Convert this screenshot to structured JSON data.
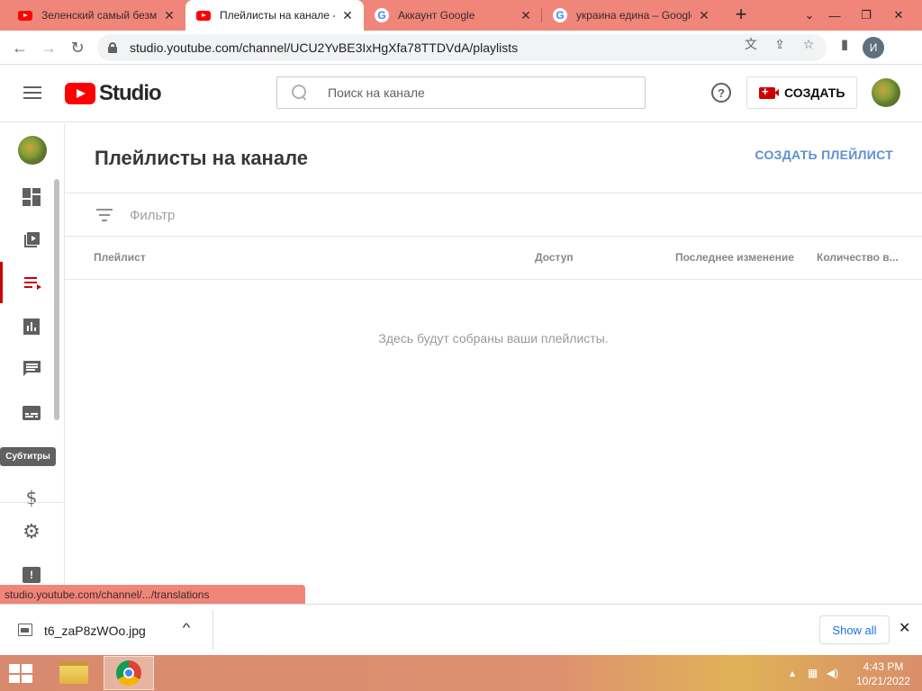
{
  "browser": {
    "tabs": [
      {
        "title": "Зеленский самый безмо",
        "favicon": "youtube-icon",
        "active": false
      },
      {
        "title": "Плейлисты на канале - Y",
        "favicon": "youtube-icon",
        "active": true
      },
      {
        "title": "Аккаунт Google",
        "favicon": "google-icon",
        "active": false
      },
      {
        "title": "украина едина – Google",
        "favicon": "google-icon",
        "active": false
      }
    ],
    "url": "studio.youtube.com/channel/UCU2YvBE3IxHgXfa78TTDVdA/playlists",
    "profile_initial": "И"
  },
  "studio": {
    "logo_text": "Studio",
    "search_placeholder": "Поиск на канале",
    "create_label": "СОЗДАТЬ",
    "help_glyph": "?"
  },
  "sidebar": {
    "items": [
      {
        "name": "dashboard",
        "icon": "dashboard-icon"
      },
      {
        "name": "content",
        "icon": "video-library-icon"
      },
      {
        "name": "playlists",
        "icon": "playlist-icon",
        "active": true
      },
      {
        "name": "analytics",
        "icon": "analytics-icon"
      },
      {
        "name": "comments",
        "icon": "comment-icon"
      },
      {
        "name": "subtitles",
        "icon": "subtitles-icon"
      },
      {
        "name": "monetization",
        "icon": "dollar-icon"
      },
      {
        "name": "settings",
        "icon": "gear-icon"
      },
      {
        "name": "feedback",
        "icon": "feedback-icon"
      }
    ],
    "tooltip": "Субтитры",
    "money_glyph": "$",
    "gear_glyph": "⚙",
    "feedback_glyph": "!"
  },
  "main": {
    "title": "Плейлисты на канале",
    "create_playlist": "СОЗДАТЬ ПЛЕЙЛИСТ",
    "filter_placeholder": "Фильтр",
    "columns": [
      "Плейлист",
      "Доступ",
      "Последнее изменение",
      "Количество в..."
    ],
    "empty_message": "Здесь будут собраны ваши плейлисты."
  },
  "status_url": "studio.youtube.com/channel/.../translations",
  "downloads": {
    "file_name": "t6_zaP8zWOo.jpg",
    "show_all": "Show all"
  },
  "taskbar": {
    "time": "4:43 PM",
    "date": "10/21/2022"
  },
  "colors": {
    "tab_strip": "#f0857a",
    "youtube_red": "#ff0000",
    "accent_link": "#5f90cf"
  }
}
